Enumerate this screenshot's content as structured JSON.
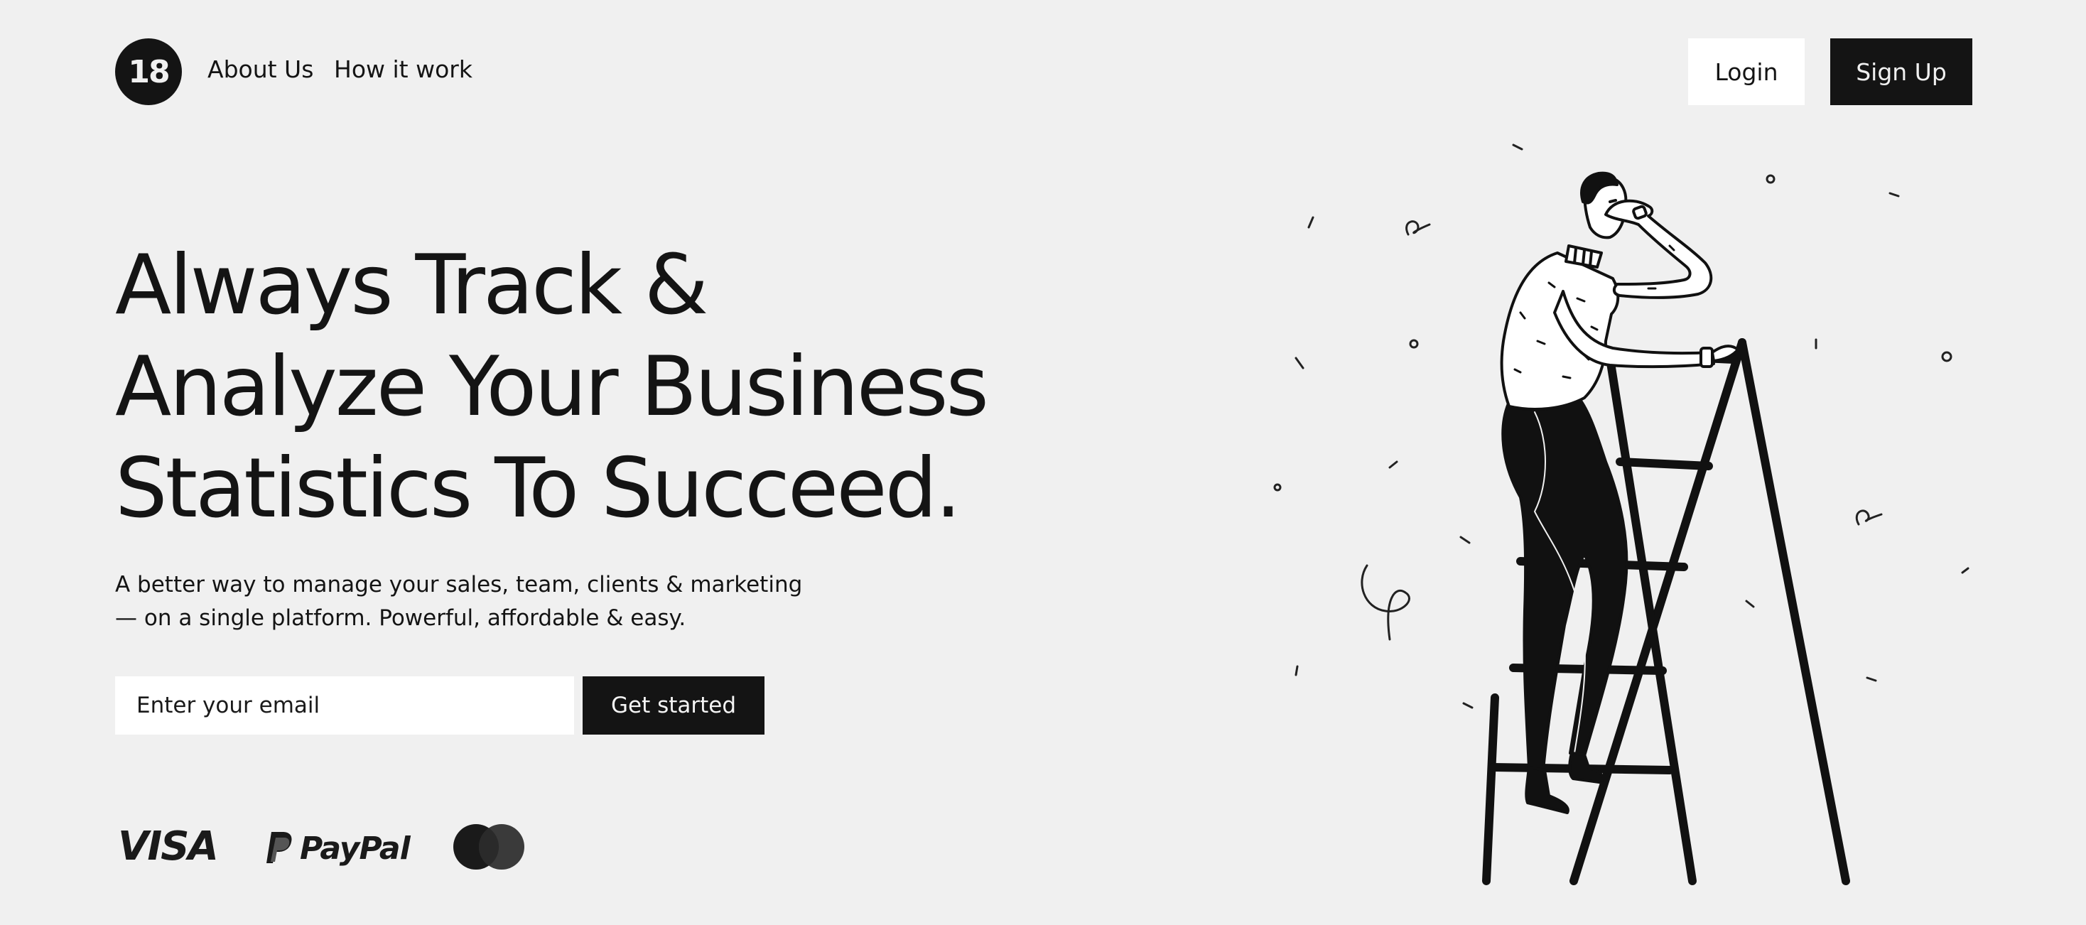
{
  "header": {
    "logo_text": "18",
    "nav": [
      {
        "label": "About Us"
      },
      {
        "label": "How it work"
      }
    ],
    "login_label": "Login",
    "signup_label": "Sign Up"
  },
  "hero": {
    "title_lines": [
      "Always Track &",
      "Analyze Your Business",
      "Statistics To Succeed."
    ],
    "subtitle_lines": [
      "A better way to manage your sales, team, clients & marketing",
      "— on a single platform. Powerful, affordable & easy."
    ],
    "email_placeholder": "Enter your email",
    "cta_label": "Get started"
  },
  "payments": {
    "visa": "VISA",
    "paypal": "PayPal",
    "mastercard_icon": "mastercard-icon"
  },
  "illustration": {
    "subject": "man-climbing-ladder-illustration"
  },
  "colors": {
    "background": "#f0f0f0",
    "dark": "#141414",
    "white": "#ffffff"
  }
}
